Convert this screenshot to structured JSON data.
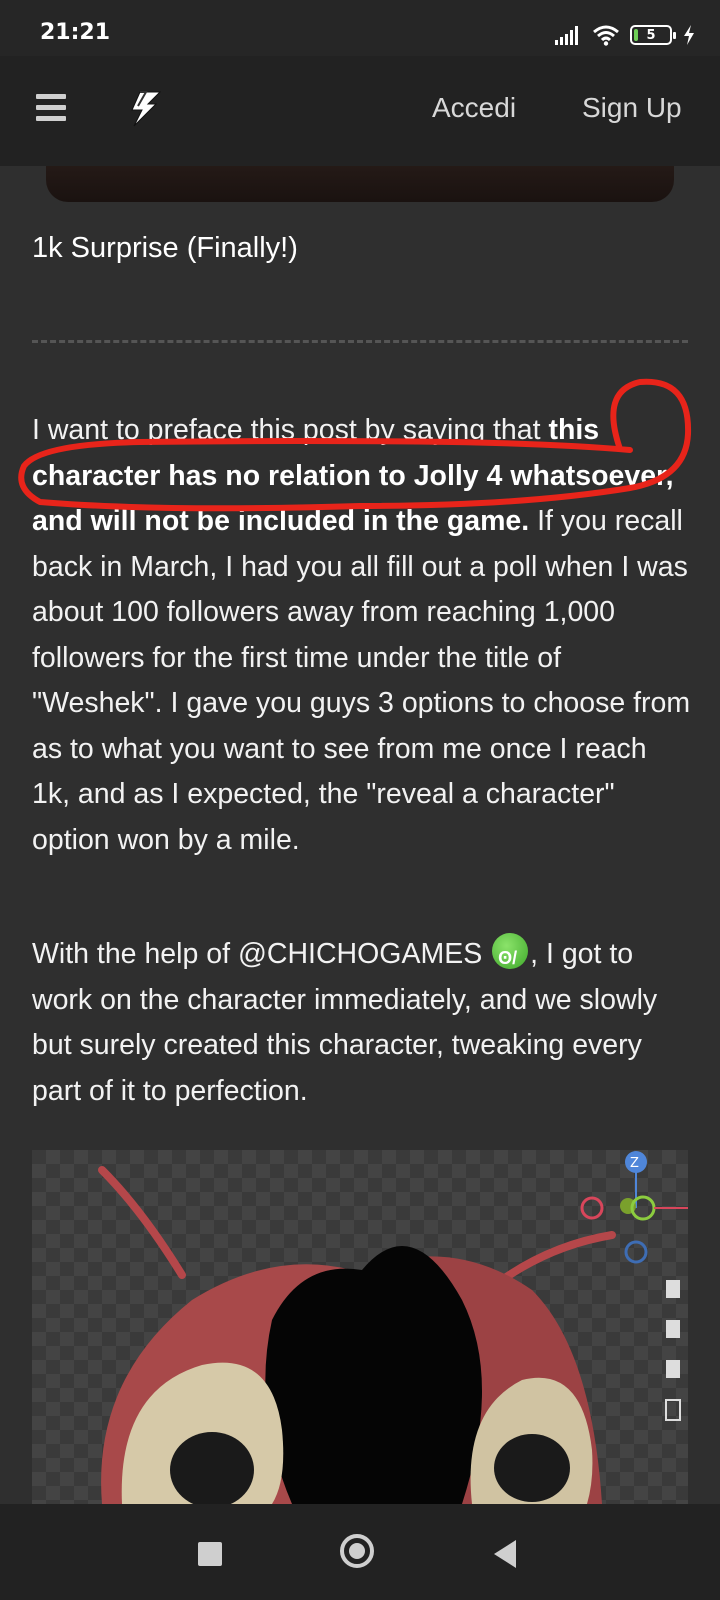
{
  "status_bar": {
    "time": "21:21",
    "battery_level": "5"
  },
  "topbar": {
    "login_label": "Accedi",
    "signup_label": "Sign Up"
  },
  "post": {
    "title": "1k Surprise (Finally!)",
    "paragraph1": {
      "intro": "I want to preface this post by saying that ",
      "bold": "this character has no relation to Jolly 4 whatsoever, and will not be included in the game.",
      "rest": " If you recall back in March, I had you all fill out a poll when I was about 100 followers away from reaching 1,000 followers for the first time under the title of \"Weshek\".  I gave you guys 3 options to choose from as to what you want to see from me once I reach 1k, and as I expected, the \"reveal a character\" option won by a mile."
    },
    "paragraph2": {
      "before_emoji": "With the help of @CHICHOGAMES ",
      "after_emoji": ", I got to work on the character immediately, and we slowly but surely created this character, tweaking every part of it to perfection."
    }
  },
  "colors": {
    "background": "#2f2f2f",
    "topbar": "#222222",
    "annotation_circle": "#e8241a"
  }
}
